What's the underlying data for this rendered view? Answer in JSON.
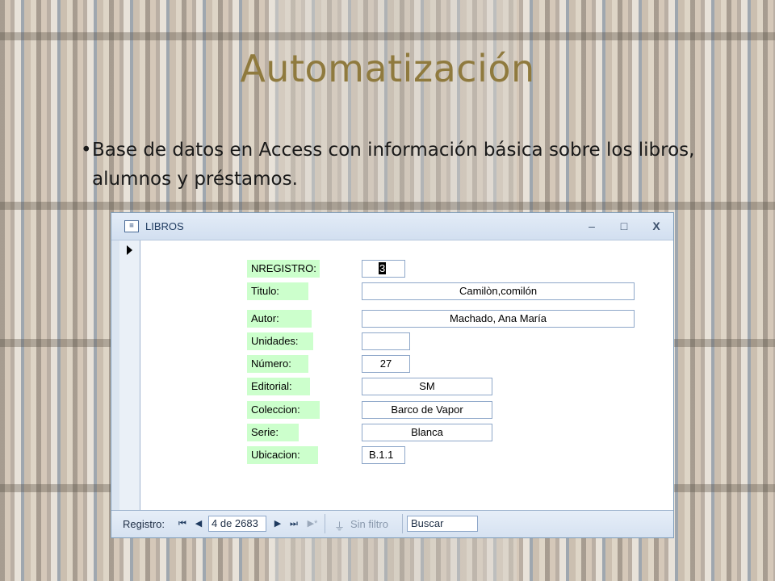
{
  "slide": {
    "title": "Automatización",
    "bullet": "Base de datos en Access con información básica sobre los libros, alumnos y préstamos."
  },
  "window": {
    "title": "LIBROS",
    "icon": "form-icon",
    "minimize": "–",
    "maximize": "□",
    "close": "X"
  },
  "form": {
    "fields": [
      {
        "label": "NREGISTRO:",
        "value": "3"
      },
      {
        "label": "Titulo:",
        "value": "Camilòn,comilón"
      },
      {
        "label": "Autor:",
        "value": "Machado, Ana María"
      },
      {
        "label": "Unidades:",
        "value": ""
      },
      {
        "label": "Número:",
        "value": "27"
      },
      {
        "label": "Editorial:",
        "value": "SM"
      },
      {
        "label": "Coleccion:",
        "value": "Barco de Vapor"
      },
      {
        "label": "Serie:",
        "value": "Blanca"
      },
      {
        "label": "Ubicacion:",
        "value": "B.1.1"
      }
    ]
  },
  "navigation": {
    "label": "Registro:",
    "first": "⏮",
    "prev": "◀",
    "record": "4 de 2683",
    "next": "▶",
    "last": "⏭",
    "new": "▶*",
    "filter": "Sin filtro",
    "search": "Buscar"
  }
}
